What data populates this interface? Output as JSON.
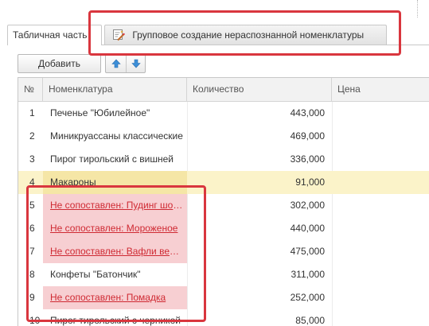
{
  "tabs": [
    {
      "label": "Табличная часть",
      "active": true
    },
    {
      "label": "Групповое создание нераспознанной номенклатуры",
      "active": false,
      "icon": "wand-edit-icon"
    }
  ],
  "toolbar": {
    "add_label": "Добавить",
    "move_up_icon": "arrow-up-icon",
    "move_down_icon": "arrow-down-icon"
  },
  "table": {
    "columns": [
      "№",
      "Номенклатура",
      "Количество",
      "Цена"
    ],
    "rows": [
      {
        "num": "1",
        "nomenclature": "Печенье \"Юбилейное\"",
        "quantity": "443,000",
        "price": "",
        "unmatched": false
      },
      {
        "num": "2",
        "nomenclature": "Миникруассаны классические",
        "quantity": "469,000",
        "price": "",
        "unmatched": false
      },
      {
        "num": "3",
        "nomenclature": "Пирог тирольский с вишней",
        "quantity": "336,000",
        "price": "",
        "unmatched": false
      },
      {
        "num": "4",
        "nomenclature": "Макароны",
        "quantity": "91,000",
        "price": "",
        "unmatched": false,
        "current": true
      },
      {
        "num": "5",
        "nomenclature": "Не сопоставлен: Пудинг шоколадный",
        "quantity": "302,000",
        "price": "",
        "unmatched": true
      },
      {
        "num": "6",
        "nomenclature": "Не сопоставлен: Мороженое",
        "quantity": "440,000",
        "price": "",
        "unmatched": true
      },
      {
        "num": "7",
        "nomenclature": "Не сопоставлен: Вафли венские",
        "quantity": "475,000",
        "price": "",
        "unmatched": true
      },
      {
        "num": "8",
        "nomenclature": "Конфеты \"Батончик\"",
        "quantity": "311,000",
        "price": "",
        "unmatched": false
      },
      {
        "num": "9",
        "nomenclature": "Не сопоставлен: Помадка",
        "quantity": "252,000",
        "price": "",
        "unmatched": true
      },
      {
        "num": "10",
        "nomenclature": "Пирог тирольский с черникой",
        "quantity": "85,000",
        "price": "",
        "unmatched": false
      }
    ]
  },
  "colors": {
    "highlight": "#d9363e",
    "unmatched_bg": "#f7cfd2",
    "unmatched_text": "#cf2a33",
    "current_row_bg": "#fbf3c9",
    "accent_arrow": "#3d8fd8"
  }
}
